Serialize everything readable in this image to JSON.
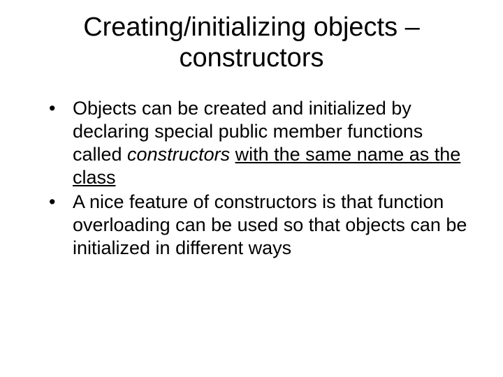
{
  "title": "Creating/initializing objects – constructors",
  "bullets": {
    "b1_part1": "Objects can be created and initialized by declaring special public member functions called ",
    "b1_italic": "constructors",
    "b1_space": " ",
    "b1_underline": "with the same name as the class",
    "b2": "A nice feature of constructors is that function overloading can be used so that objects can be initialized in different ways"
  }
}
